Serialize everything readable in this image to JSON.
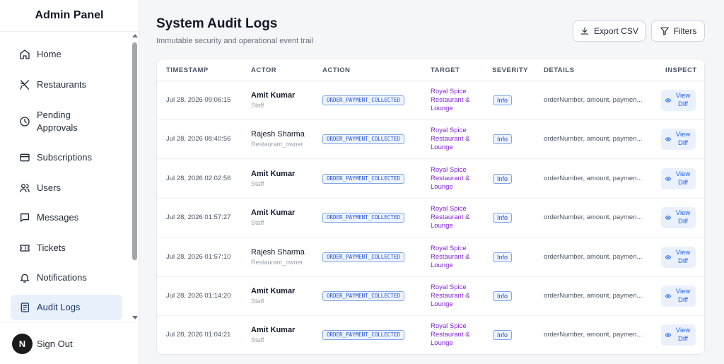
{
  "sidebar": {
    "title": "Admin Panel",
    "items": [
      {
        "label": "Home",
        "icon": "home-icon"
      },
      {
        "label": "Restaurants",
        "icon": "utensils-icon"
      },
      {
        "label": "Pending Approvals",
        "icon": "clock-icon"
      },
      {
        "label": "Subscriptions",
        "icon": "credit-card-icon"
      },
      {
        "label": "Users",
        "icon": "users-icon"
      },
      {
        "label": "Messages",
        "icon": "message-icon"
      },
      {
        "label": "Tickets",
        "icon": "ticket-icon"
      },
      {
        "label": "Notifications",
        "icon": "bell-icon"
      },
      {
        "label": "Audit Logs",
        "icon": "scroll-icon",
        "active": true
      }
    ],
    "avatar_letter": "N",
    "signout_label": "Sign Out"
  },
  "header": {
    "title": "System Audit Logs",
    "subtitle": "Immutable security and operational event trail",
    "export_label": "Export CSV",
    "filters_label": "Filters"
  },
  "table": {
    "columns": {
      "timestamp": "TIMESTAMP",
      "actor": "ACTOR",
      "action": "ACTION",
      "target": "TARGET",
      "severity": "SEVERITY",
      "details": "DETAILS",
      "inspect": "INSPECT"
    },
    "view_diff_label": "View Diff",
    "rows": [
      {
        "timestamp": "Jul 28, 2026 09:06:15",
        "actor": "Amit Kumar",
        "role": "Staff",
        "action": "ORDER_PAYMENT_COLLECTED",
        "target": "Royal Spice Restaurant & Lounge",
        "severity": "Info",
        "details": "orderNumber, amount, paymen..."
      },
      {
        "timestamp": "Jul 28, 2026 08:40:56",
        "actor": "Rajesh Sharma",
        "role": "Restaurant_owner",
        "action": "ORDER_PAYMENT_COLLECTED",
        "target": "Royal Spice Restaurant & Lounge",
        "severity": "Info",
        "details": "orderNumber, amount, paymen..."
      },
      {
        "timestamp": "Jul 28, 2026 02:02:56",
        "actor": "Amit Kumar",
        "role": "Staff",
        "action": "ORDER_PAYMENT_COLLECTED",
        "target": "Royal Spice Restaurant & Lounge",
        "severity": "Info",
        "details": "orderNumber, amount, paymen..."
      },
      {
        "timestamp": "Jul 28, 2026 01:57:27",
        "actor": "Amit Kumar",
        "role": "Staff",
        "action": "ORDER_PAYMENT_COLLECTED",
        "target": "Royal Spice Restaurant & Lounge",
        "severity": "Info",
        "details": "orderNumber, amount, paymen..."
      },
      {
        "timestamp": "Jul 28, 2026 01:57:10",
        "actor": "Rajesh Sharma",
        "role": "Restaurant_owner",
        "action": "ORDER_PAYMENT_COLLECTED",
        "target": "Royal Spice Restaurant & Lounge",
        "severity": "Info",
        "details": "orderNumber, amount, paymen..."
      },
      {
        "timestamp": "Jul 28, 2026 01:14:20",
        "actor": "Amit Kumar",
        "role": "Staff",
        "action": "ORDER_PAYMENT_COLLECTED",
        "target": "Royal Spice Restaurant & Lounge",
        "severity": "Info",
        "details": "orderNumber, amount, paymen..."
      },
      {
        "timestamp": "Jul 28, 2026 01:04:21",
        "actor": "Amit Kumar",
        "role": "Staff",
        "action": "ORDER_PAYMENT_COLLECTED",
        "target": "Royal Spice Restaurant & Lounge",
        "severity": "Info",
        "details": "orderNumber, amount, paymen..."
      }
    ]
  },
  "colors": {
    "accent": "#2563eb",
    "target_text": "#7e22ce",
    "active_nav_bg": "#e8f0fb"
  }
}
